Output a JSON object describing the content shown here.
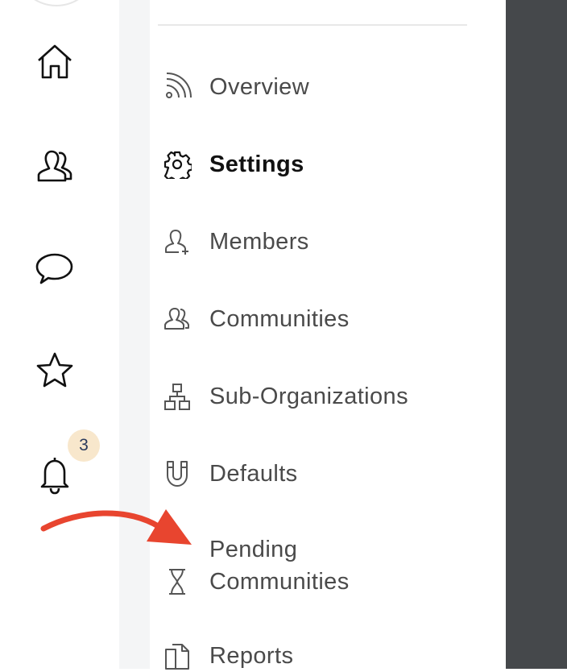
{
  "rail": {
    "icons": [
      "home-icon",
      "people-icon",
      "chat-icon",
      "star-icon",
      "bell-icon"
    ],
    "notification_count": "3"
  },
  "menu": {
    "items": [
      {
        "label": "Overview",
        "icon": "rss-icon"
      },
      {
        "label": "Settings",
        "icon": "gear-icon",
        "active": true
      },
      {
        "label": "Members",
        "icon": "user-add-icon"
      },
      {
        "label": "Communities",
        "icon": "people-icon"
      },
      {
        "label": "Sub-Organizations",
        "icon": "org-chart-icon"
      },
      {
        "label": "Defaults",
        "icon": "magnet-icon"
      },
      {
        "label_line1": "Pending",
        "label_line2": "Communities",
        "icon": "hourglass-icon"
      },
      {
        "label": "Reports",
        "icon": "document-icon"
      }
    ]
  },
  "annotation": {
    "arrow_color": "#e8452f",
    "target": "Pending Communities"
  },
  "colors": {
    "dark_panel": "#45484b",
    "badge_bg": "#f8e7cc",
    "gutter": "#f4f5f6"
  }
}
